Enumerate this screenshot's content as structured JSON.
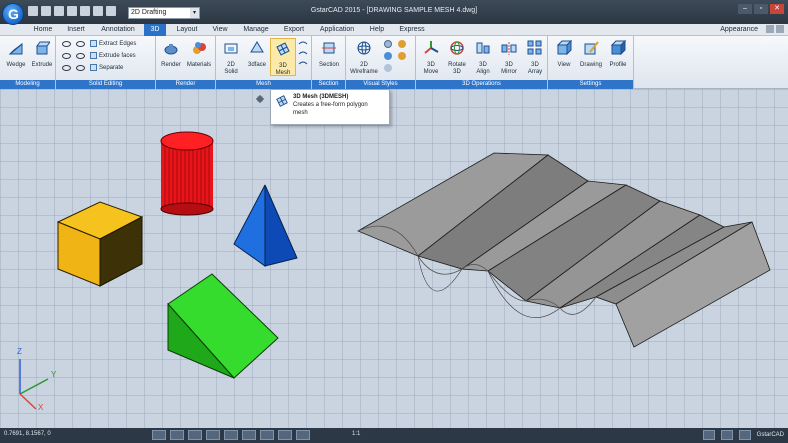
{
  "titlebar": {
    "title": "GstarCAD 2015 - [DRAWING SAMPLE MESH 4.dwg]",
    "workspace": "2D Drafting",
    "minimize": "–",
    "restore": "▫",
    "close": "✕"
  },
  "tabs": [
    "Home",
    "Insert",
    "Annotation",
    "3D",
    "Layout",
    "View",
    "Manage",
    "Export",
    "Application",
    "Help",
    "Express"
  ],
  "active_tab": "3D",
  "appearance_label": "Appearance",
  "ribbon": {
    "modeling": {
      "title": "Modeling",
      "wedge": "Wedge",
      "extrude": "Extrude"
    },
    "solid_editing": {
      "title": "Solid Editing",
      "extract_edges": "Extract Edges",
      "extrude_faces": "Extrude faces",
      "separate": "Separate"
    },
    "render": {
      "title": "Render",
      "render": "Render",
      "materials": "Materials"
    },
    "mesh": {
      "title": "Mesh",
      "solid2d_line1": "2D",
      "solid2d_line2": "Solid",
      "face3d": "3dface",
      "mesh3d_line1": "3D",
      "mesh3d_line2": "Mesh"
    },
    "section": {
      "title": "Section",
      "section": "Section"
    },
    "visual_styles": {
      "title": "Visual Styles",
      "wireframe_line1": "2D",
      "wireframe_line2": "Wireframe"
    },
    "operations": {
      "title": "3D Operations",
      "move_line1": "3D",
      "move_line2": "Move",
      "rotate_line1": "Rotate",
      "rotate_line2": "3D",
      "align_line1": "3D",
      "align_line2": "Align",
      "mirror_line1": "3D",
      "mirror_line2": "Mirror",
      "array_line1": "3D",
      "array_line2": "Array"
    },
    "settings": {
      "title": "Settings",
      "view": "View",
      "drawing": "Drawing",
      "profile": "Profile"
    }
  },
  "tooltip": {
    "title": "3D Mesh (3DMESH)",
    "line1": "Creates a free-form polygon",
    "line2": "mesh"
  },
  "ucs": {
    "x": "X",
    "y": "Y",
    "z": "Z"
  },
  "statusbar": {
    "coords": "0.7691, 8.1567, 0",
    "scale": "1:1",
    "brand": "GstarCAD"
  },
  "colors": {
    "tab_active": "#2a72c7",
    "cylinder": "#e8141a",
    "cube": "#f2b514",
    "pyramid": "#1f6fe0",
    "wedge": "#2ed12a",
    "mesh": "#8c8c8c"
  }
}
